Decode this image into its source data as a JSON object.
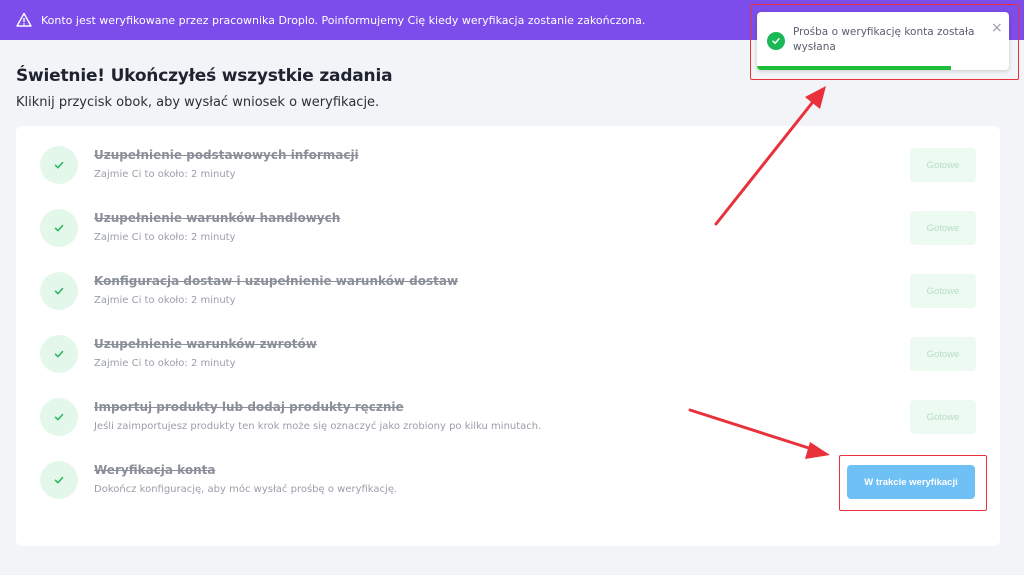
{
  "banner": {
    "text": "Konto jest weryfikowane przez pracownika Droplo. Poinformujemy Cię kiedy weryfikacja zostanie zakończona.",
    "icon": "warning-triangle-icon",
    "background": "#7c4dea"
  },
  "heading": {
    "title": "Świetnie! Ukończyłeś wszystkie zadania",
    "subtitle": "Kliknij przycisk obok, aby wysłać wniosek o weryfikacje."
  },
  "tasks": [
    {
      "title": "Uzupełnienie podstawowych informacji",
      "desc": "Zajmie Ci to około: 2 minuty",
      "button": "Gotowe",
      "done": true
    },
    {
      "title": "Uzupełnienie warunków handlowych",
      "desc": "Zajmie Ci to około: 2 minuty",
      "button": "Gotowe",
      "done": true
    },
    {
      "title": "Konfiguracja dostaw i uzupełnienie warunków dostaw",
      "desc": "Zajmie Ci to około: 2 minuty",
      "button": "Gotowe",
      "done": true
    },
    {
      "title": "Uzupełnienie warunków zwrotów",
      "desc": "Zajmie Ci to około: 2 minuty",
      "button": "Gotowe",
      "done": true
    },
    {
      "title": "Importuj produkty lub dodaj produkty ręcznie",
      "desc": "Jeśli zaimportujesz produkty ten krok może się oznaczyć jako zrobiony po kilku minutach.",
      "button": "Gotowe",
      "done": true
    },
    {
      "title": "Weryfikacja konta",
      "desc": "Dokończ konfigurację, aby móc wysłać prośbę o weryfikację.",
      "button": "W trakcie weryfikacji",
      "done": true
    }
  ],
  "toast": {
    "message": "Prośba o weryfikację konta została wysłana",
    "icon": "check-circle-icon",
    "close_icon": "close-icon",
    "progress": 0.77
  },
  "colors": {
    "accent": "#7c4dea",
    "success": "#19b955",
    "verify_button": "#6fc0f4",
    "annotation": "#e8313b"
  }
}
